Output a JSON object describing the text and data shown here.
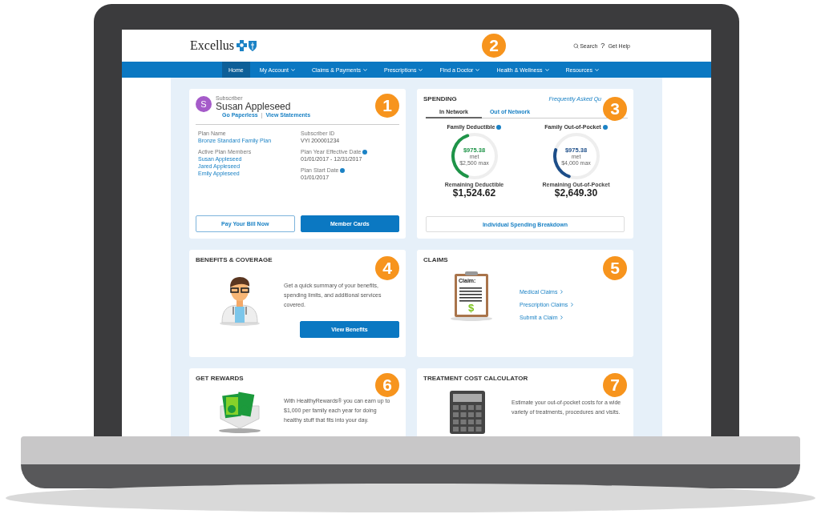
{
  "header": {
    "logo": "Excellus",
    "search": "Search",
    "help_mark": "?",
    "help": "Get Help",
    "badge": "2"
  },
  "nav": [
    {
      "label": "Home",
      "selected": true,
      "dropdown": false
    },
    {
      "label": "My Account",
      "selected": false,
      "dropdown": true
    },
    {
      "label": "Claims & Payments",
      "selected": false,
      "dropdown": true
    },
    {
      "label": "Prescriptions",
      "selected": false,
      "dropdown": true
    },
    {
      "label": "Find a Doctor",
      "selected": false,
      "dropdown": true
    },
    {
      "label": "Health & Wellness",
      "selected": false,
      "dropdown": true
    },
    {
      "label": "Resources",
      "selected": false,
      "dropdown": true
    }
  ],
  "subscriber_card": {
    "badge": "1",
    "avatar": "S",
    "role": "Subscriber",
    "name": "Susan Appleseed",
    "links": [
      "Go Paperless",
      "View Statements"
    ],
    "separator": "|",
    "field_columns": [
      [
        {
          "label": "Plan Name",
          "values": [
            "Bronze Standard Family Plan"
          ],
          "kind": "link",
          "info": false
        },
        {
          "label": "Active Plan Members",
          "values": [
            "Susan Appleseed",
            "Jared Appleseed",
            "Emily Appleseed"
          ],
          "kind": "link",
          "info": false
        }
      ],
      [
        {
          "label": "Subscriber ID",
          "values": [
            "VYI 200001234"
          ],
          "kind": "text",
          "info": false
        },
        {
          "label": "Plan Year Effective Date",
          "values": [
            "01/01/2017 - 12/31/2017"
          ],
          "kind": "text",
          "info": true
        },
        {
          "label": "Plan Start Date",
          "values": [
            "01/01/2017"
          ],
          "kind": "text",
          "info": true
        }
      ]
    ],
    "buttons": [
      {
        "label": "Pay Your Bill Now",
        "kind": "outline"
      },
      {
        "label": "Member Cards",
        "kind": "primary"
      }
    ]
  },
  "spending_card": {
    "badge": "3",
    "title": "SPENDING",
    "faq_link": "Frequently Asked Qu",
    "tabs": [
      {
        "label": "In Network",
        "selected": true
      },
      {
        "label": "Out of Network",
        "selected": false
      }
    ],
    "gauges": [
      {
        "title": "Family Deductible",
        "amount": "$975.38",
        "met": "met",
        "max": "$2,500 max",
        "level": 0.39,
        "color": "#1e9448",
        "remaining_label": "Remaining Deductible",
        "remaining": "$1,524.62"
      },
      {
        "title": "Family Out-of-Pocket",
        "amount": "$975.38",
        "met": "met",
        "max": "$4,000 max",
        "level": 0.24,
        "color": "#1d4e89",
        "remaining_label": "Remaining Out-of-Pocket",
        "remaining": "$2,649.30"
      }
    ],
    "button": "Individual Spending Breakdown"
  },
  "benefits_card": {
    "badge": "4",
    "title": "BENEFITS & COVERAGE",
    "text": "Get a quick summary of your benefits, spending limits, and additional services covered.",
    "button": "View Benefits"
  },
  "claims_card": {
    "badge": "5",
    "title": "CLAIMS",
    "clipboard_label": "Claim:",
    "clipboard_sign": "$",
    "links": [
      "Medical Claims",
      "Prescription Claims",
      "Submit a Claim"
    ]
  },
  "rewards_card": {
    "badge": "6",
    "title": "GET REWARDS",
    "text": "With HealthyRewards® you can earn up to $1,000 per family each year for doing healthy stuff that fits into your day."
  },
  "calculator_card": {
    "badge": "7",
    "title": "TREATMENT COST CALCULATOR",
    "text": "Estimate your out-of-pocket costs for a wide variety of treatments, procedures and visits."
  }
}
